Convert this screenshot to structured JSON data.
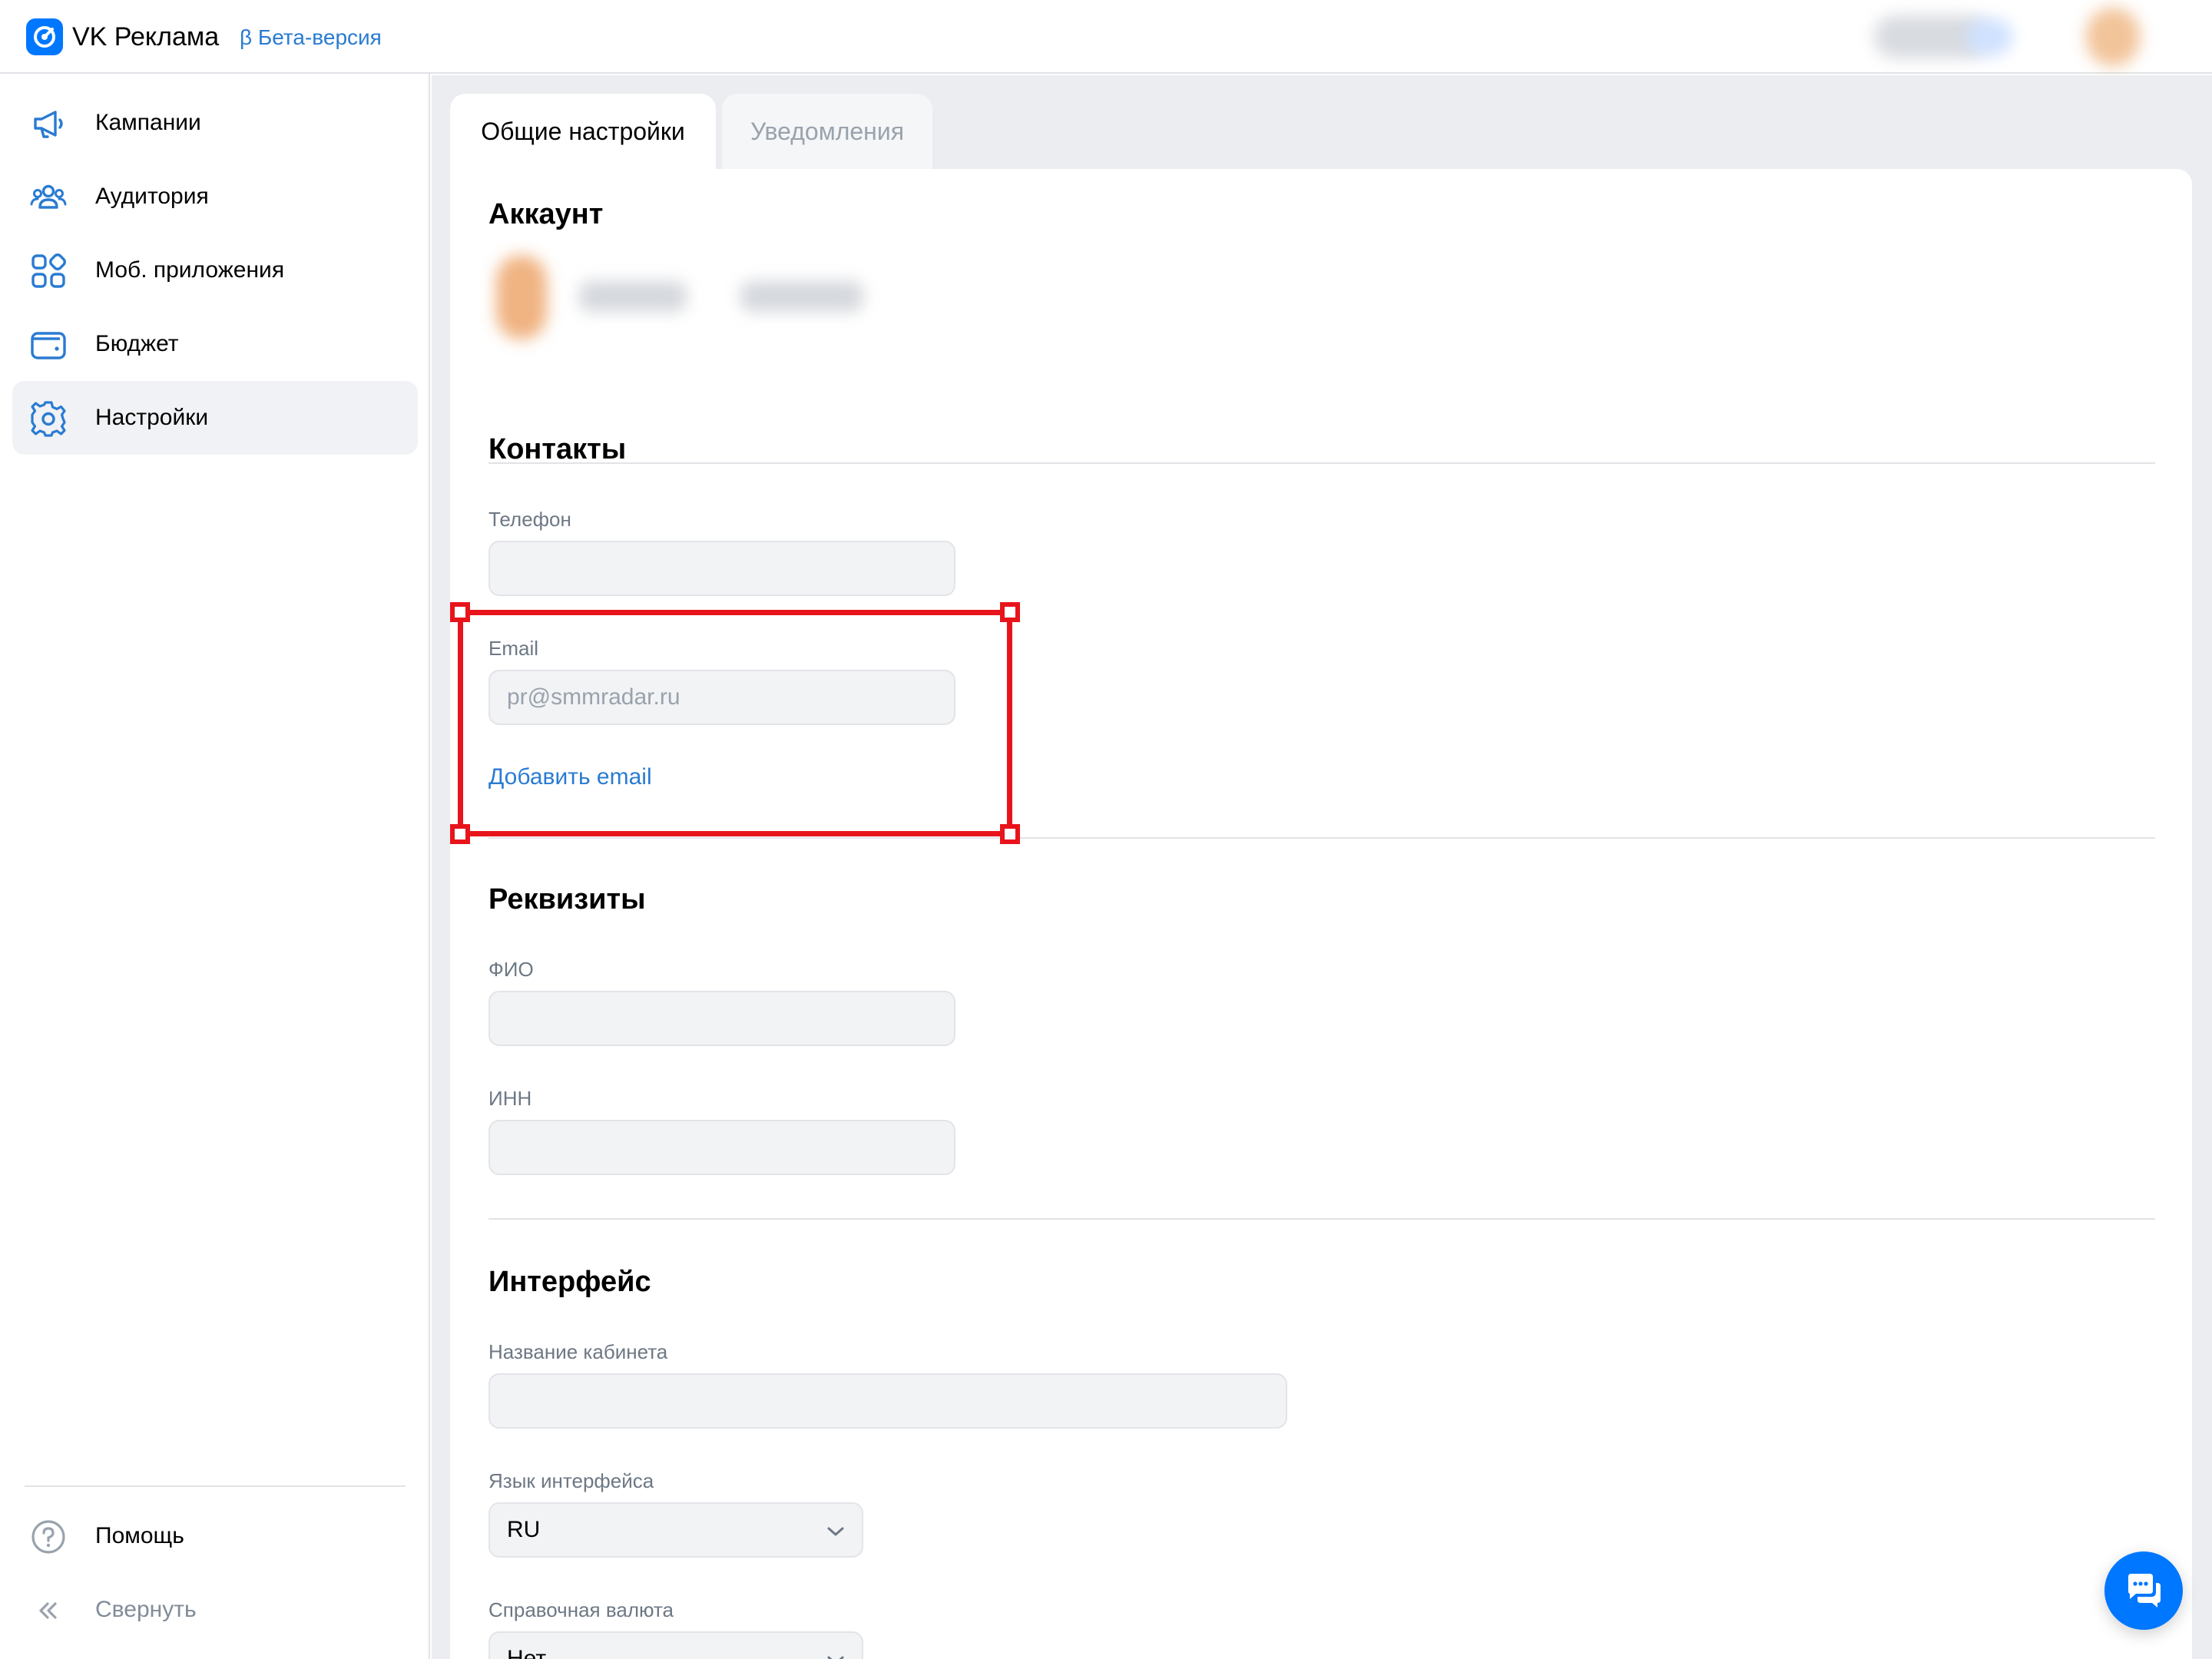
{
  "header": {
    "brand": "VK Реклама",
    "beta_label": "β Бета-версия"
  },
  "sidebar": {
    "items": [
      {
        "label": "Кампании",
        "icon": "megaphone-icon"
      },
      {
        "label": "Аудитория",
        "icon": "users-icon"
      },
      {
        "label": "Моб. приложения",
        "icon": "apps-grid-icon"
      },
      {
        "label": "Бюджет",
        "icon": "wallet-icon"
      },
      {
        "label": "Настройки",
        "icon": "gear-icon",
        "active": true
      }
    ],
    "help_label": "Помощь",
    "collapse_label": "Свернуть"
  },
  "tabs": [
    {
      "label": "Общие настройки",
      "active": true
    },
    {
      "label": "Уведомления",
      "active": false
    }
  ],
  "account": {
    "title": "Аккаунт"
  },
  "contacts": {
    "title": "Контакты",
    "phone_label": "Телефон",
    "phone_value": "",
    "email_label": "Email",
    "email_placeholder": "pr@smmradar.ru",
    "add_email_label": "Добавить email"
  },
  "requisites": {
    "title": "Реквизиты",
    "fio_label": "ФИО",
    "fio_value": "",
    "inn_label": "ИНН",
    "inn_value": ""
  },
  "interface": {
    "title": "Интерфейс",
    "cabinet_name_label": "Название кабинета",
    "cabinet_name_value": "",
    "language_label": "Язык интерфейса",
    "language_value": "RU",
    "currency_label": "Справочная валюта",
    "currency_value": "Нет"
  },
  "colors": {
    "accent": "#0077ff",
    "link": "#2a7bd2",
    "highlight": "#e8141c"
  }
}
